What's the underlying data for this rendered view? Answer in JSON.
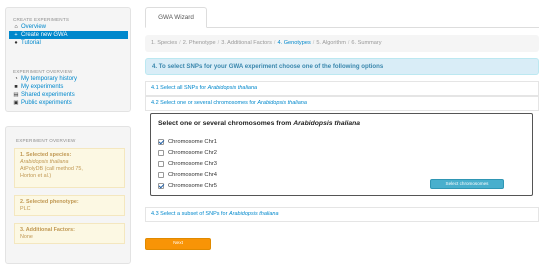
{
  "sidebar": {
    "create_header": "CREATE EXPERIMENTS",
    "create_items": [
      {
        "label": "Overview",
        "icon": "home-icon",
        "active": false
      },
      {
        "label": "Create new GWA",
        "icon": "plus-icon",
        "active": true
      },
      {
        "label": "Tutorial",
        "icon": "question-icon",
        "active": false
      }
    ],
    "exp_header": "EXPERIMENT OVERVIEW",
    "exp_items": [
      {
        "label": "My temporary history",
        "icon": "clock-icon"
      },
      {
        "label": "My experiments",
        "icon": "book-icon"
      },
      {
        "label": "Shared experiments",
        "icon": "share-icon"
      },
      {
        "label": "Public experiments",
        "icon": "globe-icon"
      }
    ]
  },
  "overview": {
    "header": "EXPERIMENT OVERVIEW",
    "species_title": "1. Selected species:",
    "species_name": "Arabidopsis thaliana",
    "species_db": "AtPolyDB (call method 75,",
    "species_ref": "Horton et al.)",
    "phenotype_title": "2. Selected phenotype:",
    "phenotype_value": "PLC",
    "factors_title": "3. Additional Factors:",
    "factors_value": "None"
  },
  "main": {
    "tab_label": "GWA Wizard",
    "breadcrumb": [
      "1. Species",
      "2. Phenotype",
      "3. Additional Factors",
      "4. Genotypes",
      "5. Algorithm",
      "6. Summary"
    ],
    "breadcrumb_sep": "/",
    "breadcrumb_current_index": 3,
    "info_header": "4. To select SNPs for your GWA experiment choose one of the following options",
    "option1_prefix": "4.1 Select all SNPs for ",
    "option2_prefix": "4.2 Select one or several chromosomes for ",
    "option3_prefix": "4.3 Select a subset of SNPs for ",
    "species_italic": "Arabidopsis thaliana",
    "chrom_title_prefix": "Select one or several chromosomes from ",
    "chromosomes": [
      {
        "label": "Chromosome Chr1",
        "checked": true
      },
      {
        "label": "Chromosome Chr2",
        "checked": false
      },
      {
        "label": "Chromosome Chr3",
        "checked": false
      },
      {
        "label": "Chromosome Chr4",
        "checked": false
      },
      {
        "label": "Chromosome Chr5",
        "checked": true
      }
    ],
    "select_button": "Select chromosomes",
    "next_button": "Next"
  },
  "colors": {
    "link": "#0088cc",
    "info_bg": "#d9edf7",
    "warning_bg": "#fcf8e3",
    "button_info": "#49afcd",
    "button_warning": "#f89406"
  }
}
